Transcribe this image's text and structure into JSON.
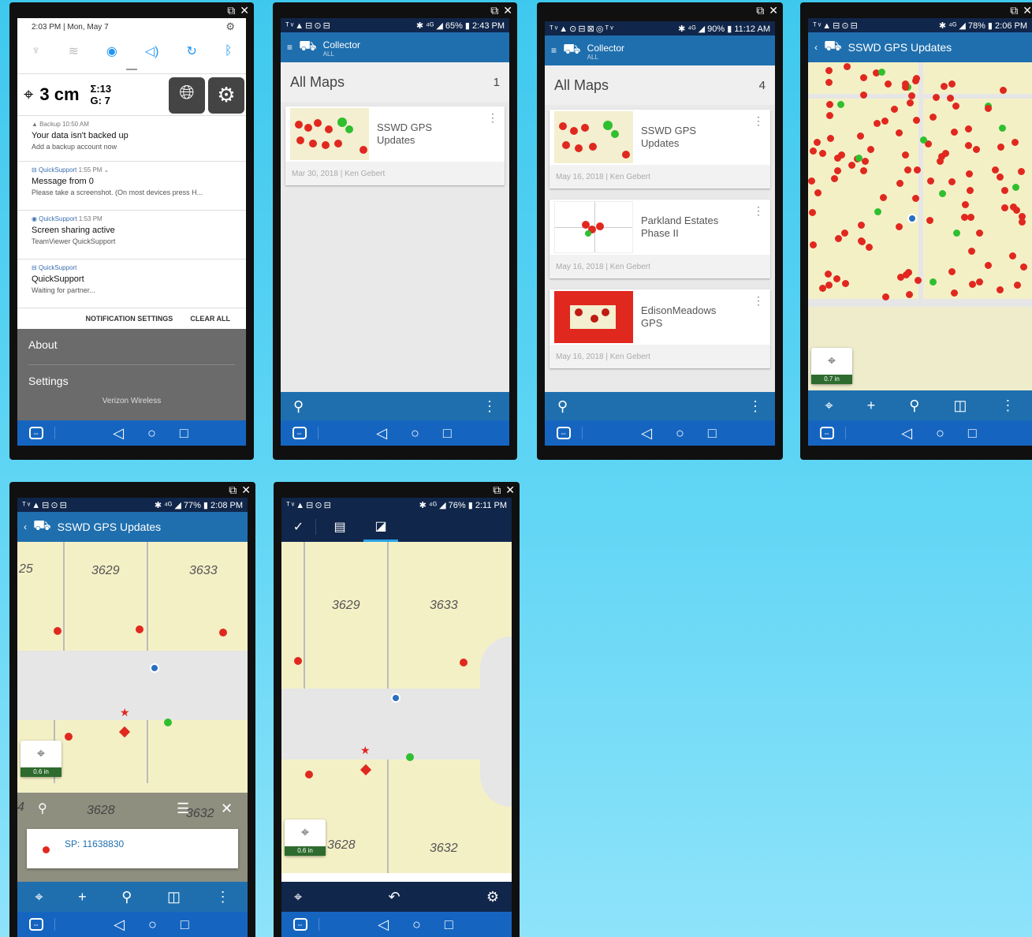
{
  "window_controls": {
    "popout": "⧉",
    "close": "✕"
  },
  "notif": {
    "time": "2:03 PM",
    "date": "Mon, May 7",
    "scale": "3 cm",
    "sigma": "Σ:13",
    "g": "G: 7",
    "items": [
      {
        "app": "Backup",
        "time": "10:50 AM",
        "title": "Your data isn't backed up",
        "body": "Add a backup account now"
      },
      {
        "app": "QuickSupport",
        "time": "1:55 PM ⌄",
        "title": "Message from 0",
        "body": "Please take a screenshot. (On most devices press H..."
      },
      {
        "app": "QuickSupport",
        "time": "1:53 PM",
        "title": "Screen sharing active",
        "body": "TeamViewer QuickSupport"
      },
      {
        "app": "QuickSupport",
        "time": "",
        "title": "QuickSupport",
        "body": "Waiting for partner..."
      }
    ],
    "notification_settings": "NOTIFICATION SETTINGS",
    "clear_all": "CLEAR ALL",
    "about": "About",
    "settings": "Settings",
    "carrier": "Verizon Wireless"
  },
  "p2": {
    "status_right": "✱ ⁴ᴳ ◢ 65% ▮ 2:43 PM",
    "app": "Collector",
    "app_sub": "ALL",
    "heading": "All Maps",
    "count": "1",
    "cards": [
      {
        "title": "SSWD GPS Updates",
        "date": "Mar 30, 2018",
        "author": "Ken Gebert"
      }
    ]
  },
  "p3": {
    "status_right": "✱ ⁴ᴳ ◢ 90% ▮ 11:12 AM",
    "app": "Collector",
    "app_sub": "ALL",
    "heading": "All Maps",
    "count": "4",
    "cards": [
      {
        "title": "SSWD GPS Updates",
        "date": "May 16, 2018",
        "author": "Ken Gebert"
      },
      {
        "title": "Parkland Estates Phase II",
        "date": "May 16, 2018",
        "author": "Ken Gebert"
      },
      {
        "title": "EdisonMeadows GPS",
        "date": "May 16, 2018",
        "author": "Ken Gebert"
      }
    ]
  },
  "p4": {
    "status_right": "✱ ⁴ᴳ ◢ 78% ▮ 2:06 PM",
    "title": "SSWD GPS Updates",
    "scale": "0.7 in"
  },
  "p5": {
    "status_right": "✱ ⁴ᴳ ◢ 77% ▮ 2:08 PM",
    "title": "SSWD GPS Updates",
    "parcels": [
      "25",
      "3629",
      "3633",
      "3628",
      "3632",
      "4"
    ],
    "scale": "0.6 in",
    "popup_label": "SP: 11638830"
  },
  "p6": {
    "status_right": "✱ ⁴ᴳ ◢ 76% ▮ 2:11 PM",
    "parcels": [
      "3629",
      "3633",
      "3628",
      "3632"
    ],
    "scale": "0.6 in"
  },
  "colors": {
    "appbar": "#1f6fae",
    "nav": "#1565c0",
    "parcel": "#f4f0c6",
    "point_red": "#e0281f",
    "point_green": "#2fbf2f",
    "gps_blue": "#2a6fc0"
  }
}
